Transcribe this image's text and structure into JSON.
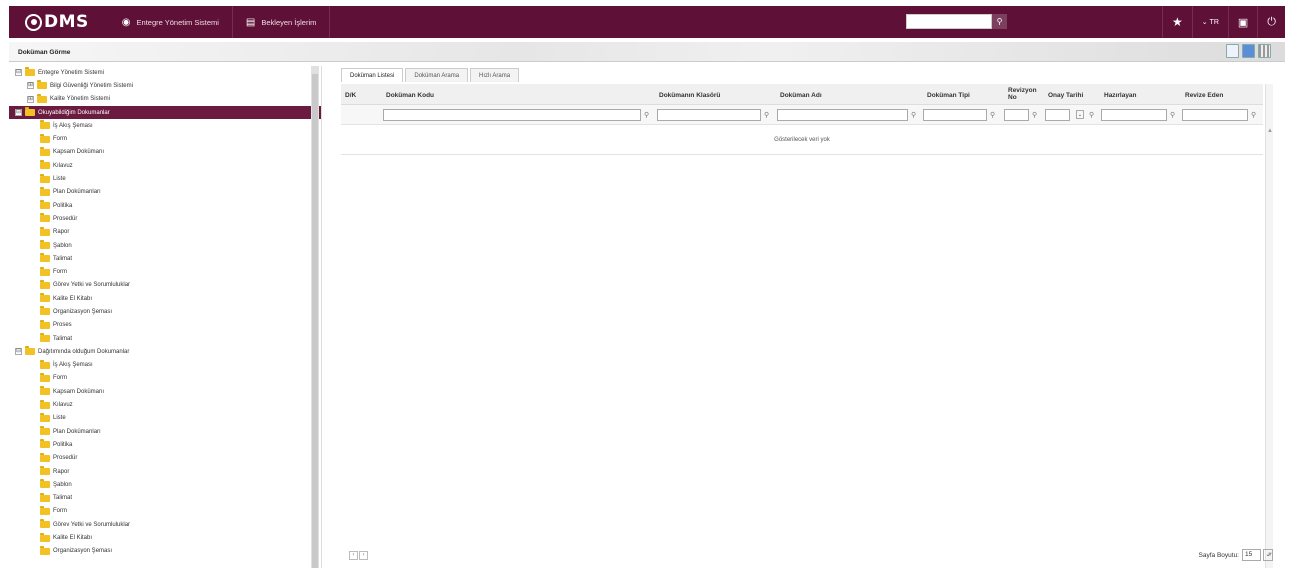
{
  "header": {
    "logo": "DMS",
    "nav": [
      {
        "label": "Entegre Yönetim Sistemi",
        "icon": "target-icon"
      },
      {
        "label": "Bekleyen İşlerim",
        "icon": "clipboard-icon"
      }
    ],
    "search_icon": "search-icon",
    "language": "TR",
    "accent_color": "#5e1036"
  },
  "page": {
    "title": "Doküman Görme"
  },
  "tree": {
    "items": [
      {
        "label": "Entegre Yönetim Sistemi",
        "level": 0,
        "toggle": "⊟"
      },
      {
        "label": "Bilgi Güvenliği Yönetim Sistemi",
        "level": 1,
        "toggle": "⊞"
      },
      {
        "label": "Kalite Yönetim Sistemi",
        "level": 1,
        "toggle": "⊞"
      },
      {
        "label": "Okuyabildiğim Dokumanlar",
        "level": 0,
        "toggle": "⊟",
        "selected": true
      },
      {
        "label": "İş Akış Şeması",
        "level": 2
      },
      {
        "label": "Form",
        "level": 2
      },
      {
        "label": "Kapsam Dokümanı",
        "level": 2
      },
      {
        "label": "Kılavuz",
        "level": 2
      },
      {
        "label": "Liste",
        "level": 2
      },
      {
        "label": "Plan Dokümanları",
        "level": 2
      },
      {
        "label": "Politika",
        "level": 2
      },
      {
        "label": "Prosedür",
        "level": 2
      },
      {
        "label": "Rapor",
        "level": 2
      },
      {
        "label": "Şablon",
        "level": 2
      },
      {
        "label": "Talimat",
        "level": 2
      },
      {
        "label": "Form",
        "level": 2
      },
      {
        "label": "Görev Yetki ve Sorumluluklar",
        "level": 2
      },
      {
        "label": "Kalite El Kitabı",
        "level": 2
      },
      {
        "label": "Organizasyon Şeması",
        "level": 2
      },
      {
        "label": "Proses",
        "level": 2
      },
      {
        "label": "Talimat",
        "level": 2
      },
      {
        "label": "Dağıtımında olduğum Dokumanlar",
        "level": 0,
        "toggle": "⊟"
      },
      {
        "label": "İş Akış Şeması",
        "level": 2
      },
      {
        "label": "Form",
        "level": 2
      },
      {
        "label": "Kapsam Dokümanı",
        "level": 2
      },
      {
        "label": "Kılavuz",
        "level": 2
      },
      {
        "label": "Liste",
        "level": 2
      },
      {
        "label": "Plan Dokümanları",
        "level": 2
      },
      {
        "label": "Politika",
        "level": 2
      },
      {
        "label": "Prosedür",
        "level": 2
      },
      {
        "label": "Rapor",
        "level": 2
      },
      {
        "label": "Şablon",
        "level": 2
      },
      {
        "label": "Talimat",
        "level": 2
      },
      {
        "label": "Form",
        "level": 2
      },
      {
        "label": "Görev Yetki ve Sorumluluklar",
        "level": 2
      },
      {
        "label": "Kalite El Kitabı",
        "level": 2
      },
      {
        "label": "Organizasyon Şeması",
        "level": 2
      }
    ]
  },
  "tabs": [
    "Doküman Listesi",
    "Doküman Arama",
    "Hızlı Arama"
  ],
  "grid": {
    "columns": [
      "D/K",
      "Doküman Kodu",
      "Dokümanın Klasörü",
      "Doküman Adı",
      "Doküman Tipi",
      "Revizyon No",
      "Onay Tarihi",
      "Hazırlayan",
      "Revize Eden"
    ],
    "empty_message": "Gösterilecek veri yok",
    "page_size_label": "Sayfa Boyutu:",
    "page_size": "15"
  }
}
